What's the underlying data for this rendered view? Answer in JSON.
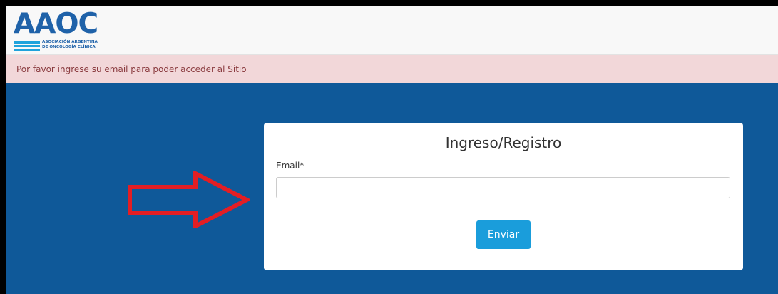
{
  "header": {
    "logo": {
      "main_text": "AAOC",
      "sub_line1": "ASOCIACIÓN ARGENTINA",
      "sub_line2": "DE ONCOLOGÍA CLÍNICA"
    }
  },
  "alert": {
    "message": "Por favor ingrese su email para poder acceder al Sitio"
  },
  "login_form": {
    "title": "Ingreso/Registro",
    "email_label": "Email*",
    "email_value": "",
    "email_placeholder": "",
    "submit_label": "Enviar"
  },
  "colors": {
    "page_background": "#0f5999",
    "brand_blue": "#1f62a9",
    "brand_cyan": "#1fa3dc",
    "alert_background": "#f2d7d9",
    "alert_text": "#8a3b3f",
    "button": "#1a9ddb",
    "annotation_arrow": "#e31e24"
  },
  "annotations": {
    "arrow_icon": "right-arrow-outline-icon"
  }
}
